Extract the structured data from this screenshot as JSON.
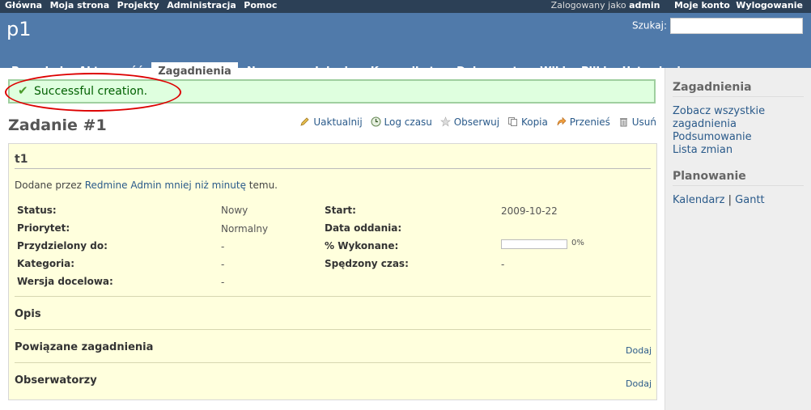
{
  "top_menu": {
    "left_items": [
      "Główna",
      "Moja strona",
      "Projekty",
      "Administracja",
      "Pomoc"
    ],
    "logged_in_text": "Zalogowany jako",
    "user": "admin",
    "account": "Moje konto",
    "logout": "Wylogowanie"
  },
  "header": {
    "project_title": "p1",
    "search_label": "Szukaj:",
    "search_value": ""
  },
  "tabs": [
    {
      "label": "Przegląd",
      "active": false
    },
    {
      "label": "Aktywność",
      "active": false
    },
    {
      "label": "Zagadnienia",
      "active": true
    },
    {
      "label": "Nowe zagadnienie",
      "active": false
    },
    {
      "label": "Komunikaty",
      "active": false
    },
    {
      "label": "Dokumenty",
      "active": false
    },
    {
      "label": "Wiki",
      "active": false
    },
    {
      "label": "Pliki",
      "active": false
    },
    {
      "label": "Ustawienia",
      "active": false
    }
  ],
  "flash": {
    "message": "Successful creation.",
    "icon": "check-icon"
  },
  "issue": {
    "title": "Zadanie #1",
    "actions": [
      {
        "label": "Uaktualnij",
        "icon": "pencil-icon"
      },
      {
        "label": "Log czasu",
        "icon": "clock-icon"
      },
      {
        "label": "Obserwuj",
        "icon": "star-icon"
      },
      {
        "label": "Kopia",
        "icon": "copy-icon"
      },
      {
        "label": "Przenieś",
        "icon": "move-icon"
      },
      {
        "label": "Usuń",
        "icon": "trash-icon"
      }
    ],
    "subject": "t1",
    "author_prefix": "Dodane przez",
    "author": "Redmine Admin",
    "time_ago": "mniej niż minutę",
    "time_suffix": "temu.",
    "attributes_left": [
      {
        "label": "Status:",
        "value": "Nowy"
      },
      {
        "label": "Priorytet:",
        "value": "Normalny"
      },
      {
        "label": "Przydzielony do:",
        "value": "-"
      },
      {
        "label": "Kategoria:",
        "value": "-"
      },
      {
        "label": "Wersja docelowa:",
        "value": "-"
      }
    ],
    "attributes_right": [
      {
        "label": "Start:",
        "value": "2009-10-22"
      },
      {
        "label": "Data oddania:",
        "value": ""
      },
      {
        "label": "% Wykonane:",
        "value": "0%"
      },
      {
        "label": "Spędzony czas:",
        "value": "-"
      }
    ],
    "done_ratio": 0,
    "description_label": "Opis",
    "related_label": "Powiązane zagadnienia",
    "related_add": "Dodaj",
    "watchers_label": "Obserwatorzy",
    "watchers_add": "Dodaj"
  },
  "sidebar": {
    "issues_title": "Zagadnienia",
    "issues_links": [
      "Zobacz wszystkie zagadnienia",
      "Podsumowanie",
      "Lista zmian"
    ],
    "planning_title": "Planowanie",
    "calendar": "Kalendarz",
    "separator": "|",
    "gantt": "Gantt"
  }
}
